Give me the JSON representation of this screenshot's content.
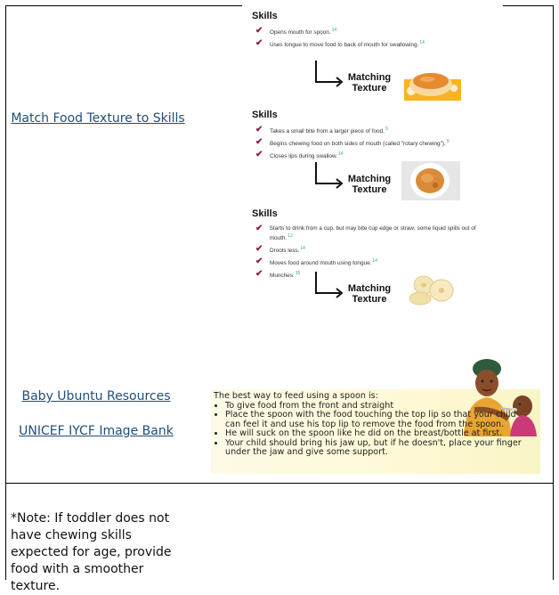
{
  "links": {
    "match_food": "Match Food Texture to Skills",
    "baby_ubuntu": "Baby Ubuntu Resources",
    "unicef": "UNICEF IYCF Image Bank"
  },
  "note": "*Note: If toddler does not have chewing skills expected for age, provide food with a smoother texture.",
  "skills_sections": [
    {
      "title": "Skills",
      "items": [
        {
          "text": "Opens mouth for spoon.",
          "ref": "14"
        },
        {
          "text": "Uses tongue to move food to back of mouth for swallowing.",
          "ref": "14"
        }
      ],
      "matching": "Matching Texture"
    },
    {
      "title": "Skills",
      "items": [
        {
          "text": "Takes a small bite from a larger piece of food.",
          "ref": "9"
        },
        {
          "text": "Begins chewing food on both sides of mouth (called \"rotary chewing\").",
          "ref": "9"
        },
        {
          "text": "Closes lips during swallow.",
          "ref": "14"
        }
      ],
      "matching": "Matching Texture"
    },
    {
      "title": "Skills",
      "items": [
        {
          "text": "Starts to drink from a cup, but may bite cup edge or straw; some liquid spills out of mouth.",
          "ref": "12"
        },
        {
          "text": "Drools less.",
          "ref": "14"
        },
        {
          "text": "Moves food around mouth using tongue.",
          "ref": "14"
        },
        {
          "text": "Munches.",
          "ref": "15"
        }
      ],
      "matching": "Matching Texture"
    }
  ],
  "spoon_panel": {
    "heading": "The best way to feed using a spoon is:",
    "bullets": [
      "To give food from the front and straight",
      "Place the spoon with the food touching the top lip so that your child can feel it and use his top lip to remove the food from the spoon.",
      "He will suck on the spoon like he did on the breast/bottle at first.",
      "Your child should bring his jaw up, but if he doesn't, place your finger under the jaw and give some support."
    ]
  },
  "colors": {
    "check": "#8b1d4f",
    "link": "#1f4e79",
    "ref": "#2aa6a1"
  }
}
